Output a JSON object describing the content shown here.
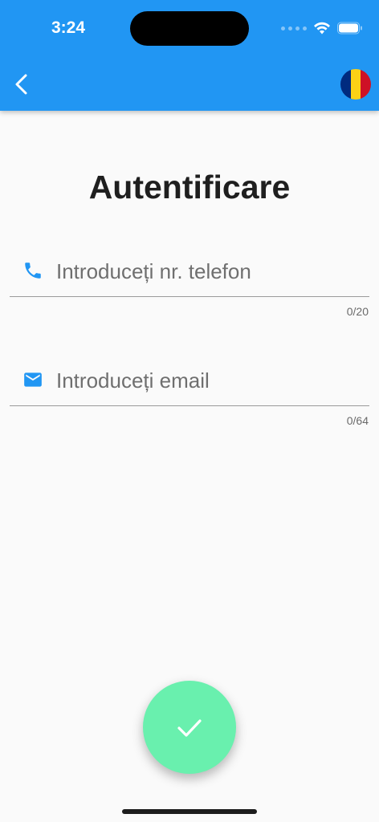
{
  "status_bar": {
    "time": "3:24"
  },
  "app_bar": {
    "back_icon": "chevron-left-icon",
    "language_flag": "romania-flag-icon",
    "flag_colors": [
      "#002B7F",
      "#FCD116",
      "#CE1126"
    ]
  },
  "page": {
    "title": "Autentificare"
  },
  "form": {
    "phone": {
      "icon": "phone-icon",
      "placeholder": "Introduceți nr. telefon",
      "value": "",
      "counter": "0/20"
    },
    "email": {
      "icon": "email-icon",
      "placeholder": "Introduceți email",
      "value": "",
      "counter": "0/64"
    }
  },
  "submit": {
    "icon": "check-icon",
    "color": "#69f0ae"
  },
  "colors": {
    "primary": "#2196f3",
    "accent": "#69f0ae",
    "background": "#fafafa"
  }
}
